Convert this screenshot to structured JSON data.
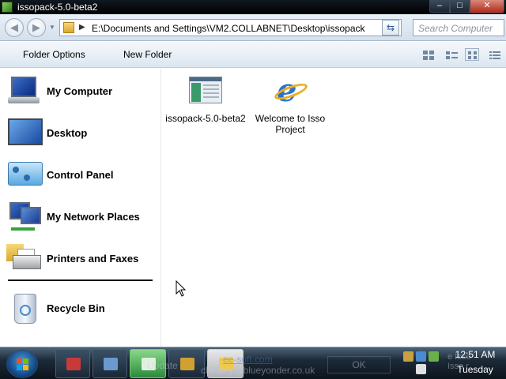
{
  "window": {
    "title": "issopack-5.0-beta2",
    "controls": {
      "minimize": "–",
      "maximize": "□",
      "close": "✕"
    }
  },
  "addressbar": {
    "path": "E:\\Documents and Settings\\VM2.COLLABNET\\Desktop\\issopack",
    "search_placeholder": "Search Computer"
  },
  "toolbar": {
    "folder_options": "Folder Options",
    "new_folder": "New Folder"
  },
  "sidebar": {
    "items": [
      {
        "label": "My Computer",
        "icon": "computer-icon"
      },
      {
        "label": "Desktop",
        "icon": "desktop-icon"
      },
      {
        "label": "Control Panel",
        "icon": "control-panel-icon"
      },
      {
        "label": "My Network Places",
        "icon": "network-icon"
      },
      {
        "label": "Printers and Faxes",
        "icon": "printer-icon"
      },
      {
        "label": "Recycle Bin",
        "icon": "recycle-bin-icon"
      }
    ]
  },
  "files": [
    {
      "name": "issopack-5.0-beta2",
      "icon": "setup-app-icon"
    },
    {
      "name": "Welcome to Isso Project",
      "icon": "internet-explorer-icon"
    }
  ],
  "taskbar": {
    "ghost_text": {
      "update": "Update",
      "link": "ee-soft.com",
      "email": "chealey@blueyonder.co.uk",
      "ok": "OK",
      "right1": "e Isso",
      "right2": "Isso r"
    },
    "clock": {
      "time": "12:51 AM",
      "day": "Tuesday"
    }
  },
  "colors": {
    "titlebar": "#000000",
    "taskbar": "#1c2a38",
    "accent": "#2a72d0"
  }
}
